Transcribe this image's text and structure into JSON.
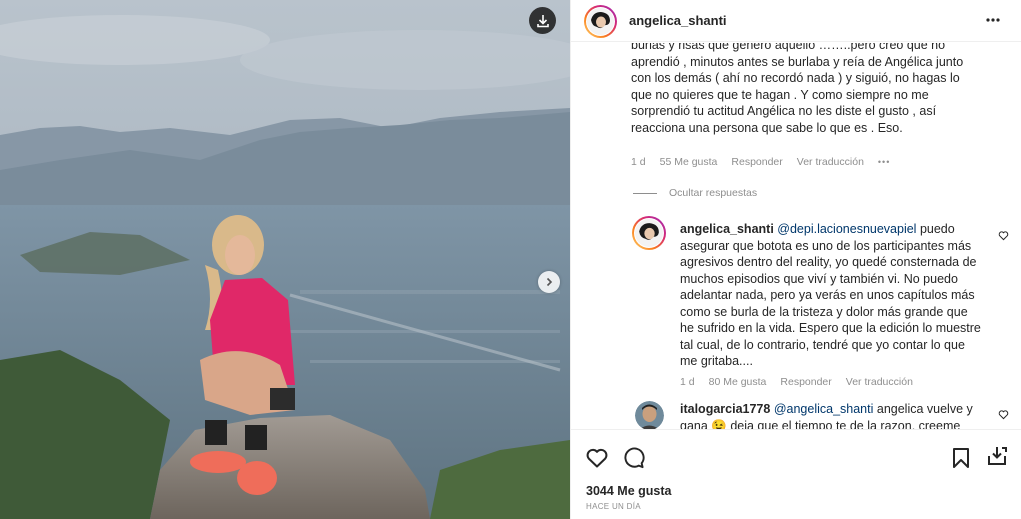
{
  "post": {
    "username": "angelica_shanti",
    "likes": "3044 Me gusta",
    "time": "HACE UN DÍA"
  },
  "icons": {
    "download": "download-icon",
    "next": "chevron-right-icon",
    "more": "more-horizontal-icon",
    "heart": "heart-icon",
    "comment": "comment-icon",
    "bookmark": "bookmark-icon",
    "share": "share-icon"
  },
  "comments": {
    "first": {
      "text_partial": "burlas y risas que generó aquello ……..pero creo que no aprendió , minutos antes se burlaba y reía de Angélica junto con los demás ( ahí no recordó nada ) y siguió, no hagas lo que no quieres que te hagan . Y como siempre no me sorprendió tu actitud Angélica no les diste el gusto , así reacciona una persona que sabe lo que es . Eso.",
      "age": "1 d",
      "likes": "55 Me gusta",
      "reply": "Responder",
      "translate": "Ver traducción",
      "more": "•••"
    },
    "hide_replies": "Ocultar respuestas",
    "reply1": {
      "user": "angelica_shanti",
      "mention": "@depi.lacionesnuevapiel",
      "text": " puedo asegurar que bototа es uno de los participantes más agresivos dentro del reality, yo quedé consternada de muchos episodios que viví y también vi. No puedo adelantar nada, pero ya verás en unos capítulos más como se burla de la tristeza y dolor más grande que he sufrido en la vida. Espero que la edición lo muestre tal cual, de lo contrario, tendré que yo contar lo que me gritaba....",
      "age": "1 d",
      "likes": "80 Me gusta",
      "reply": "Responder",
      "translate": "Ver traducción"
    },
    "reply2": {
      "user": "italogarcia1778",
      "mention": "@angelica_shanti",
      "text": " angelica vuelve y gana 😉 deja que el tiempo te de la razon, creeme"
    }
  },
  "colors": {
    "text": "#262626",
    "secondary": "#8e8e8e",
    "mention": "#00376b",
    "border": "#efefef"
  }
}
